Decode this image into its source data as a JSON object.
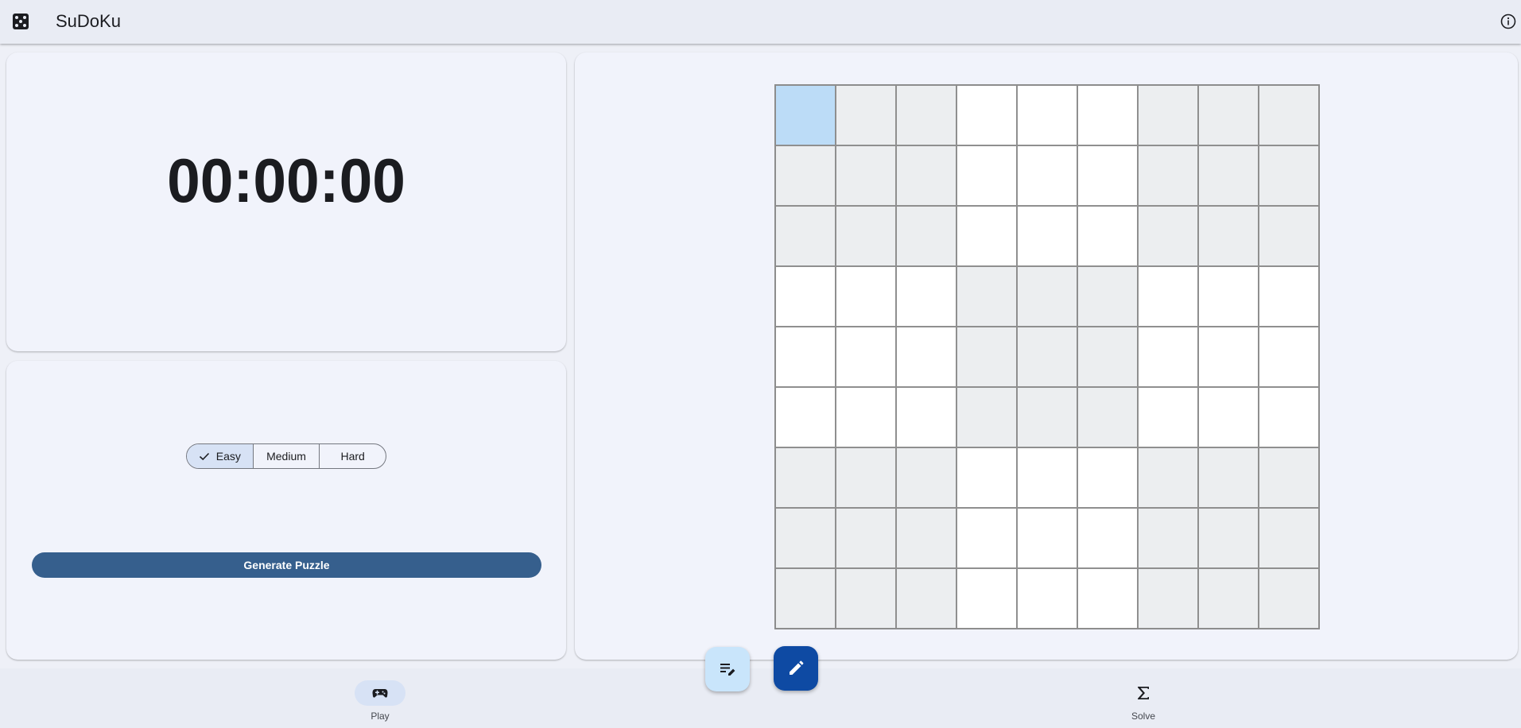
{
  "app": {
    "title": "SuDoKu",
    "logo_icon": "dice-five-icon",
    "info_icon": "info-icon"
  },
  "timer": {
    "display": "00:00:00"
  },
  "difficulty": {
    "options": [
      "Easy",
      "Medium",
      "Hard"
    ],
    "selected": "Easy",
    "check_icon": "check-icon"
  },
  "generate": {
    "label": "Generate Puzzle"
  },
  "board": {
    "size": 9,
    "selected_cell": [
      0,
      0
    ],
    "values": [
      [
        "",
        "",
        "",
        "",
        "",
        "",
        "",
        "",
        ""
      ],
      [
        "",
        "",
        "",
        "",
        "",
        "",
        "",
        "",
        ""
      ],
      [
        "",
        "",
        "",
        "",
        "",
        "",
        "",
        "",
        ""
      ],
      [
        "",
        "",
        "",
        "",
        "",
        "",
        "",
        "",
        ""
      ],
      [
        "",
        "",
        "",
        "",
        "",
        "",
        "",
        "",
        ""
      ],
      [
        "",
        "",
        "",
        "",
        "",
        "",
        "",
        "",
        ""
      ],
      [
        "",
        "",
        "",
        "",
        "",
        "",
        "",
        "",
        ""
      ],
      [
        "",
        "",
        "",
        "",
        "",
        "",
        "",
        "",
        ""
      ],
      [
        "",
        "",
        "",
        "",
        "",
        "",
        "",
        "",
        ""
      ]
    ]
  },
  "fabs": {
    "notes_icon": "notes-edit-icon",
    "edit_icon": "pencil-icon"
  },
  "nav": {
    "items": [
      {
        "label": "Play",
        "icon": "gamepad-icon",
        "active": true
      },
      {
        "label": "Solve",
        "icon": "sigma-icon",
        "active": false
      }
    ]
  },
  "colors": {
    "primary": "#365f8d",
    "selected_cell": "#bcdcf7",
    "shaded_box": "#eceef0",
    "edit_fab": "#0e4aa3",
    "notes_fab": "#c9e5fb"
  }
}
